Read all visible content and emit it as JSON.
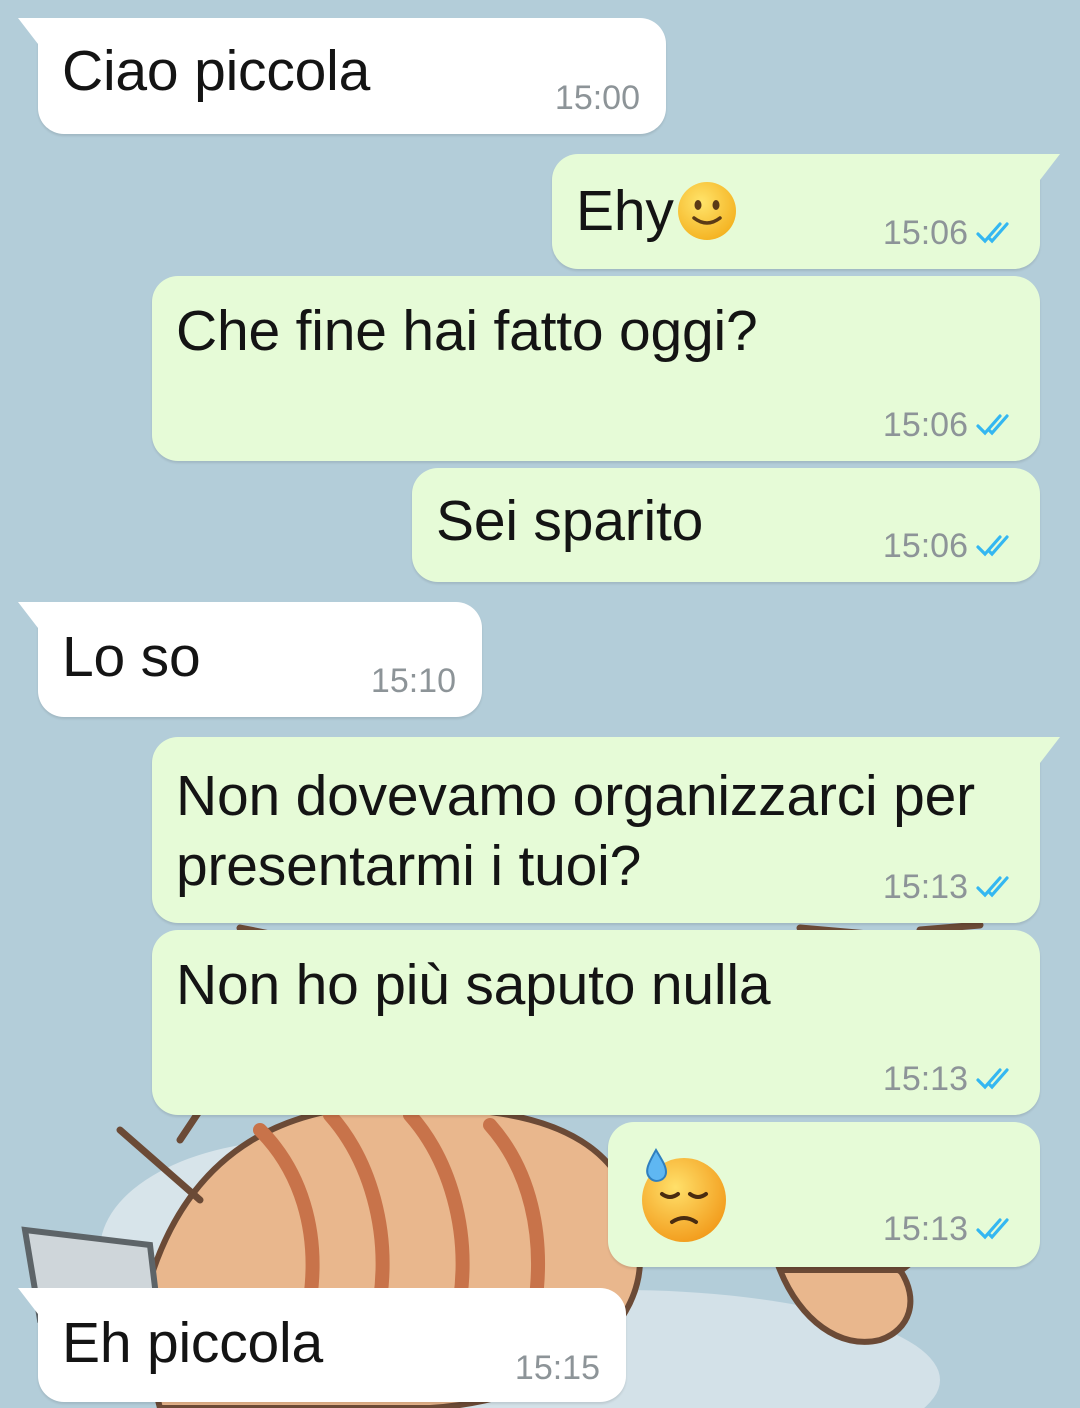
{
  "chat": {
    "messages": [
      {
        "direction": "in",
        "text": "Ciao piccola",
        "time": "15:00"
      },
      {
        "direction": "out",
        "text": "Ehy",
        "emoji": "slightly-smiling-face-icon",
        "time": "15:06",
        "status": "read"
      },
      {
        "direction": "out",
        "text": "Che fine hai fatto oggi?",
        "time": "15:06",
        "status": "read"
      },
      {
        "direction": "out",
        "text": "Sei sparito",
        "time": "15:06",
        "status": "read"
      },
      {
        "direction": "in",
        "text": "Lo so",
        "time": "15:10"
      },
      {
        "direction": "out",
        "text": "Non dovevamo organizzarci per",
        "text2": "presentarmi i tuoi?",
        "time": "15:13",
        "status": "read"
      },
      {
        "direction": "out",
        "text": "Non ho più saputo nulla",
        "time": "15:13",
        "status": "read"
      },
      {
        "direction": "out",
        "text": "",
        "emoji": "downcast-face-with-sweat-icon",
        "time": "15:13",
        "status": "read"
      },
      {
        "direction": "in",
        "text": "Eh piccola",
        "time": "15:15"
      }
    ]
  },
  "colors": {
    "background": "#b3cdd9",
    "incoming_bubble": "#ffffff",
    "outgoing_bubble": "#e6fbd7",
    "read_check": "#34b7f1",
    "timestamp": "#8d9498"
  }
}
